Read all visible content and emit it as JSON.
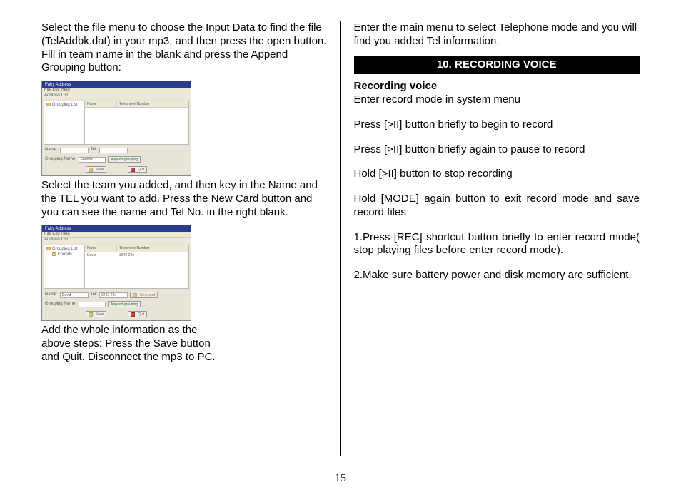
{
  "pageNumber": "15",
  "left": {
    "p1": "Select the file menu to choose the Input Data to find the file (TelAddbk.dat) in your mp3, and then press the open button. Fill in team name in the blank and press the Append Grouping button:",
    "p2": "Select the team you added, and then key in the Name and the TEL you want to add. Press the New Card button and you can see the name and Tel No. in the right blank.",
    "p3": "Add the whole information as the above steps: Press the Save button and Quit. Disconnect the mp3 to PC."
  },
  "right": {
    "p1": "Enter the main menu to select Telephone mode and you will find you added Tel information.",
    "sectionTitle": "10. RECORDING VOICE",
    "subTitle": "Recording voice",
    "p2": "Enter record mode in system menu",
    "p3": "Press [>II] button briefly to begin to record",
    "p4": "Press [>II] button briefly again to pause to record",
    "p5": "Hold [>II] button to stop recording",
    "p6": "Hold [MODE] again button to exit record mode and save record files",
    "p7": "1.Press [REC] shortcut button briefly to enter record mode( stop playing files before enter record mode).",
    "p8": "2.Make sure battery power and disk memory are sufficient."
  },
  "win1": {
    "title": "Fairy Address",
    "menu": "File  Edit  Help",
    "addressList": "Address List",
    "tree": "Grouping List",
    "colName": "Name",
    "colTel": "Telephone Number",
    "labelName": "Name:",
    "labelTel": "Tel:",
    "labelGrouping": "Grouping Name:",
    "groupingVal": "Friends",
    "btnAppend": "Append grouping",
    "btnSave": "Save",
    "btnQuit": "Quit"
  },
  "win2": {
    "title": "Fairy Address",
    "menu": "File  Edit  Help",
    "addressList": "Address List",
    "tree1": "Grouping List",
    "tree2": "Friends",
    "colName": "Name",
    "colTel": "Telephone Number",
    "rowName": "David",
    "rowTel": "3242-24x",
    "labelName": "Name:",
    "nameVal": "David",
    "labelTel": "Tel:",
    "telVal": "3242-24x",
    "labelGrouping": "Grouping Name:",
    "btnNew": "New card",
    "btnAppend": "Append grouping",
    "btnSave": "Save",
    "btnQuit": "Quit"
  }
}
